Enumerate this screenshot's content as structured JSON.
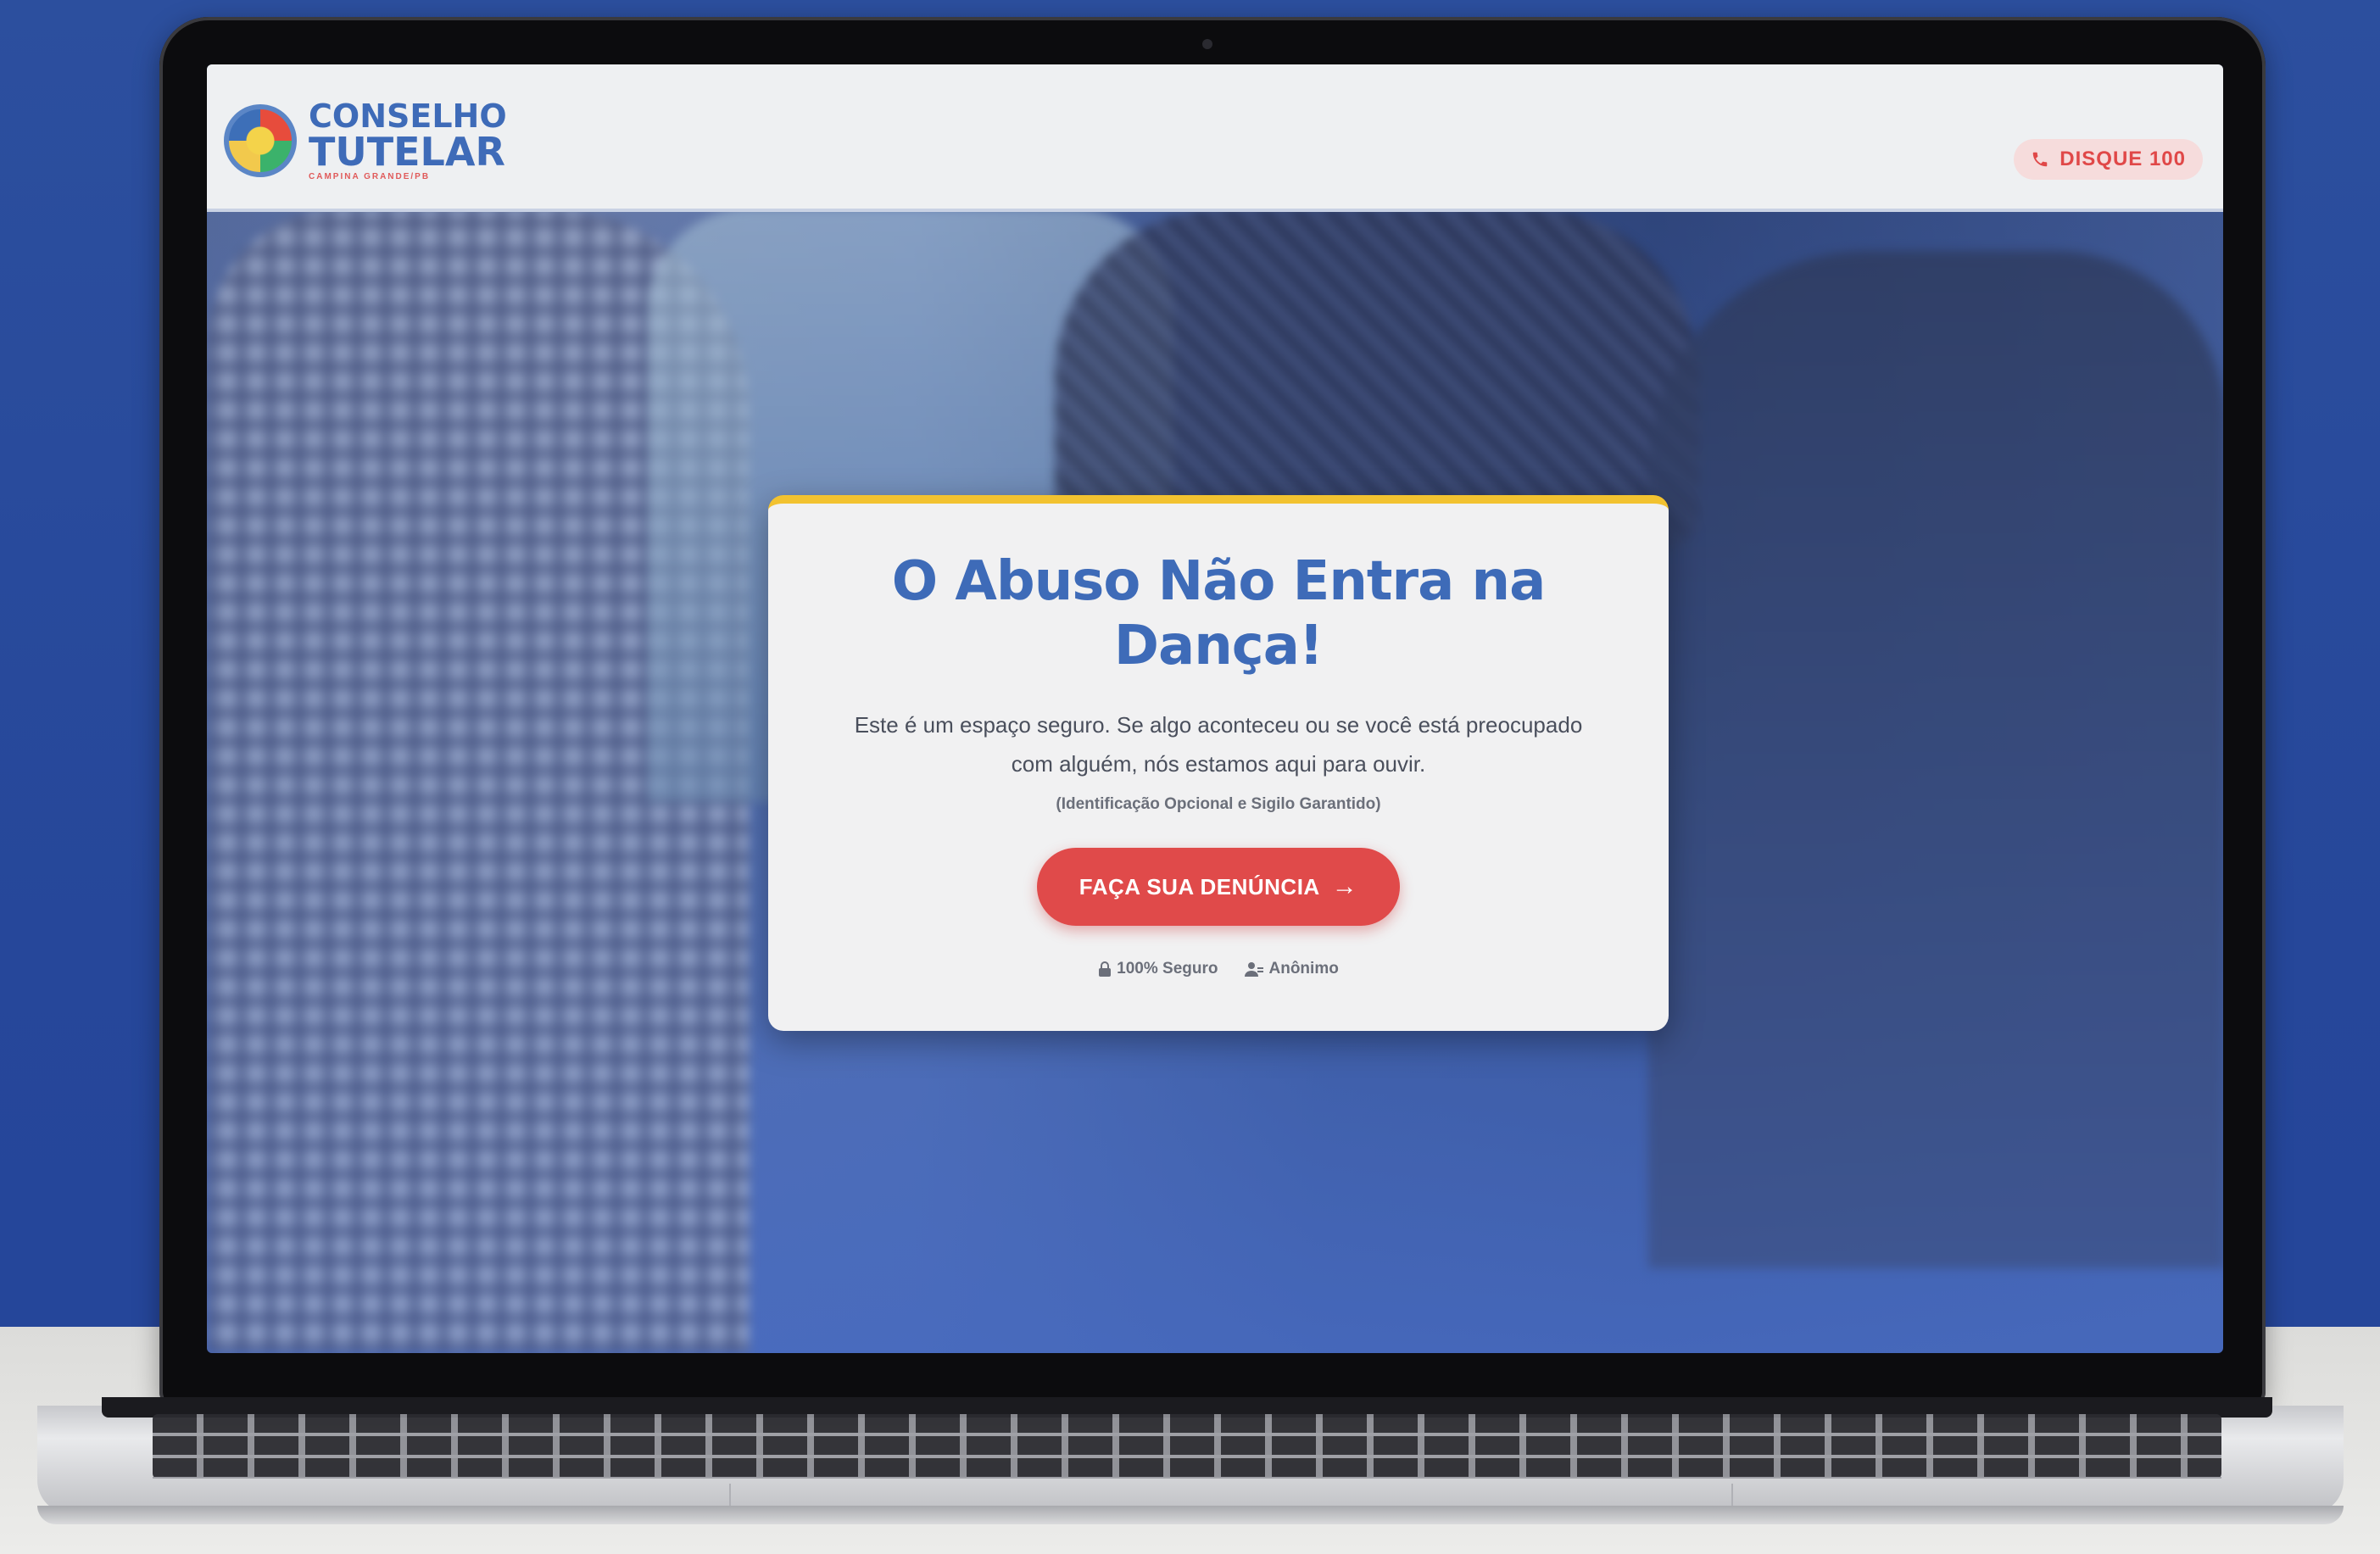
{
  "header": {
    "logo": {
      "line1": "CONSELHO",
      "line2": "TUTELAR",
      "subtitle": "CAMPINA GRANDE/PB",
      "emblem_icon": "conselho-tutelar-emblem"
    },
    "hotline": {
      "label": "DISQUE 100",
      "icon": "phone-icon"
    }
  },
  "hero": {
    "title": "O Abuso Não Entra na Dança!",
    "body": "Este é um espaço seguro. Se algo aconteceu ou se você está preocupado com alguém, nós estamos aqui para ouvir.",
    "note": "(Identificação Opcional e Sigilo Garantido)",
    "cta_label": "FAÇA SUA DENÚNCIA",
    "cta_icon": "arrow-right-icon",
    "badges": [
      {
        "icon": "lock-icon",
        "label": "100% Seguro"
      },
      {
        "icon": "user-secret-icon",
        "label": "Anônimo"
      }
    ]
  },
  "colors": {
    "brand_blue": "#3e6bb8",
    "accent_red": "#e04a4a",
    "accent_yellow": "#f2c230",
    "background_blue": "#2c4f9e"
  }
}
